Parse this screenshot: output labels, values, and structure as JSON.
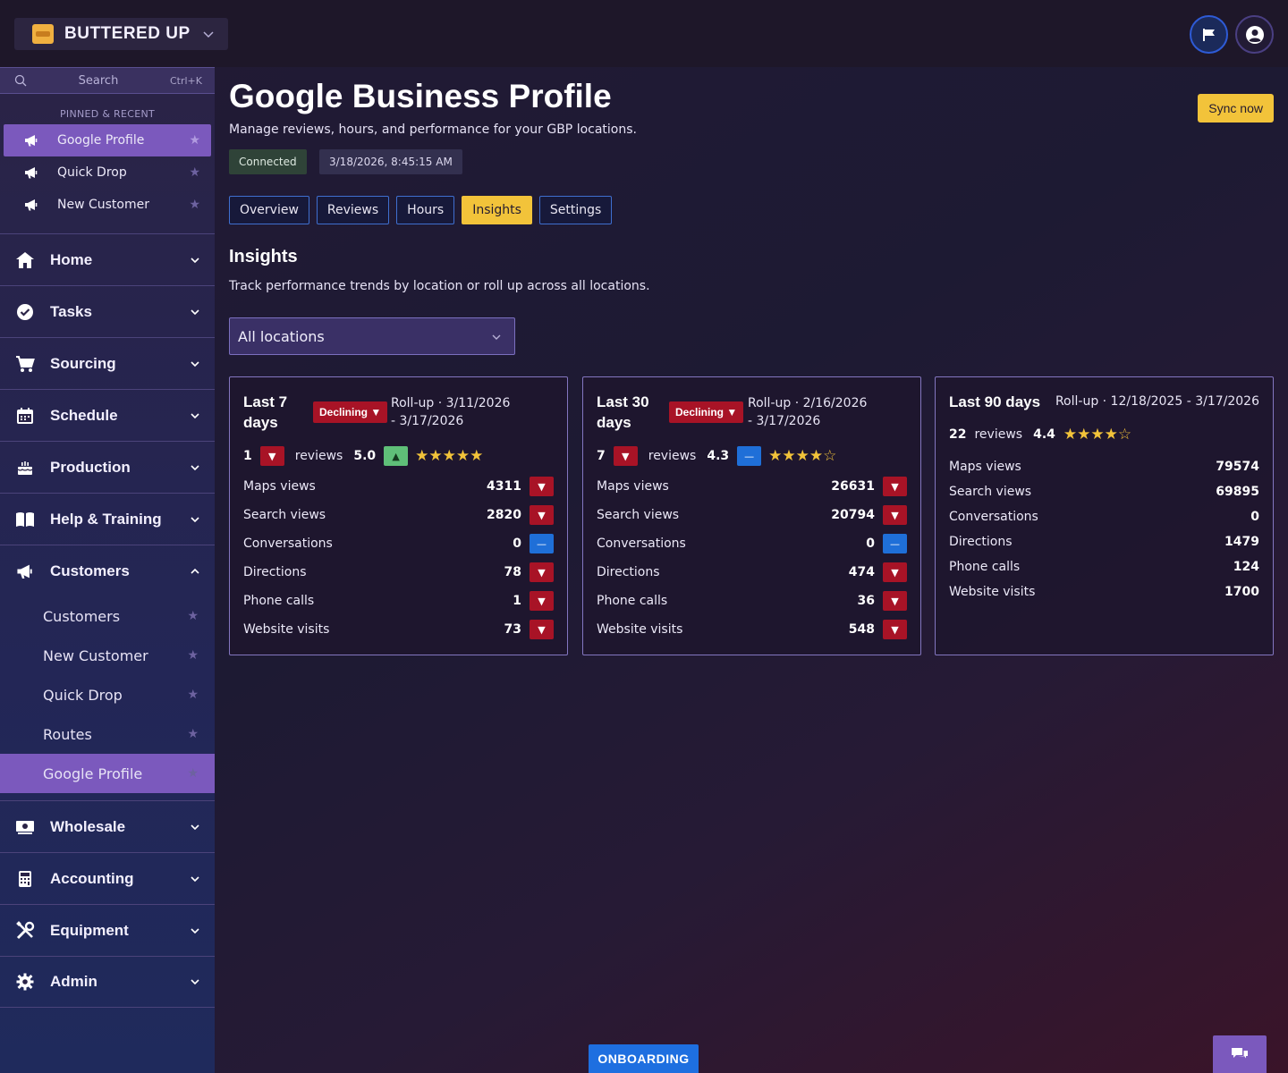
{
  "app": {
    "brand_name": "BUTTERED UP"
  },
  "sidebar": {
    "search_placeholder": "Search",
    "search_shortcut": "Ctrl+K",
    "pinned_label": "PINNED & RECENT",
    "pinned": [
      {
        "label": "Google Profile",
        "active": true
      },
      {
        "label": "Quick Drop",
        "active": false
      },
      {
        "label": "New Customer",
        "active": false
      }
    ],
    "groups": [
      {
        "label": "Home",
        "icon": "home-icon"
      },
      {
        "label": "Tasks",
        "icon": "check-badge-icon"
      },
      {
        "label": "Sourcing",
        "icon": "cart-icon"
      },
      {
        "label": "Schedule",
        "icon": "calendar-icon"
      },
      {
        "label": "Production",
        "icon": "cake-icon"
      },
      {
        "label": "Help & Training",
        "icon": "book-icon"
      },
      {
        "label": "Customers",
        "icon": "megaphone-icon"
      },
      {
        "label": "Wholesale",
        "icon": "money-icon"
      },
      {
        "label": "Accounting",
        "icon": "calculator-icon"
      },
      {
        "label": "Equipment",
        "icon": "tools-icon"
      },
      {
        "label": "Admin",
        "icon": "gear-icon"
      }
    ],
    "customers_sub": [
      {
        "label": "Customers",
        "active": false
      },
      {
        "label": "New Customer",
        "active": false
      },
      {
        "label": "Quick Drop",
        "active": false
      },
      {
        "label": "Routes",
        "active": false
      },
      {
        "label": "Google Profile",
        "active": true
      }
    ]
  },
  "header": {
    "title": "Google Business Profile",
    "subtitle": "Manage reviews, hours, and performance for your GBP locations.",
    "sync_label": "Sync now",
    "status_badge": "Connected",
    "timestamp": "3/18/2026, 8:45:15 AM"
  },
  "tabs": [
    "Overview",
    "Reviews",
    "Hours",
    "Insights",
    "Settings"
  ],
  "active_tab": "Insights",
  "insights": {
    "title": "Insights",
    "subtitle": "Track performance trends by location or roll up across all locations.",
    "location_select": "All locations",
    "cards": [
      {
        "period": "Last 7 days",
        "trend": "Declining ▼",
        "rollup": "Roll-up · 3/11/2026 - 3/17/2026",
        "reviews_count": "1",
        "reviews_label": "reviews",
        "rating": "5.0",
        "stars": "★★★★★",
        "metrics": [
          {
            "label": "Maps views",
            "value": "4311"
          },
          {
            "label": "Search views",
            "value": "2820"
          },
          {
            "label": "Conversations",
            "value": "0"
          },
          {
            "label": "Directions",
            "value": "78"
          },
          {
            "label": "Phone calls",
            "value": "1"
          },
          {
            "label": "Website visits",
            "value": "73"
          }
        ]
      },
      {
        "period": "Last 30 days",
        "trend": "Declining ▼",
        "rollup": "Roll-up · 2/16/2026 - 3/17/2026",
        "reviews_count": "7",
        "reviews_label": "reviews",
        "rating": "4.3",
        "stars": "★★★★☆",
        "metrics": [
          {
            "label": "Maps views",
            "value": "26631"
          },
          {
            "label": "Search views",
            "value": "20794"
          },
          {
            "label": "Conversations",
            "value": "0"
          },
          {
            "label": "Directions",
            "value": "474"
          },
          {
            "label": "Phone calls",
            "value": "36"
          },
          {
            "label": "Website visits",
            "value": "548"
          }
        ]
      },
      {
        "period": "Last 90 days",
        "rollup": "Roll-up · 12/18/2025 - 3/17/2026",
        "reviews_count": "22",
        "reviews_label": "reviews",
        "rating": "4.4",
        "stars": "★★★★☆",
        "metrics": [
          {
            "label": "Maps views",
            "value": "79574"
          },
          {
            "label": "Search views",
            "value": "69895"
          },
          {
            "label": "Conversations",
            "value": "0"
          },
          {
            "label": "Directions",
            "value": "1479"
          },
          {
            "label": "Phone calls",
            "value": "124"
          },
          {
            "label": "Website visits",
            "value": "1700"
          }
        ]
      }
    ]
  },
  "footer": {
    "onboarding_label": "ONBOARDING"
  },
  "colors": {
    "accent": "#f2c33a",
    "active_nav": "#7b59bd",
    "declining": "#a81326",
    "up": "#5fbf78",
    "flat": "#1f6fd8"
  }
}
